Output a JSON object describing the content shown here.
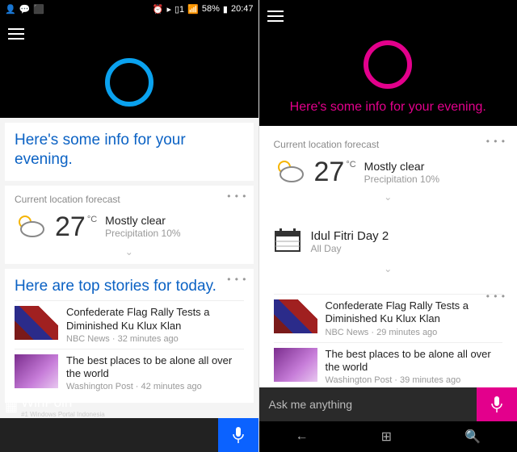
{
  "left": {
    "statusbar": {
      "battery": "58%",
      "time": "20:47"
    },
    "greeting": "Here's some info for your evening.",
    "forecast": {
      "label": "Current location forecast",
      "temp": "27",
      "unit": "°C",
      "condition": "Mostly clear",
      "precip": "Precipitation 10%"
    },
    "stories_heading": "Here are top stories for today.",
    "stories": [
      {
        "title": "Confederate Flag Rally Tests a Diminished Ku Klux Klan",
        "source": "NBC News",
        "age": "32 minutes ago"
      },
      {
        "title": "The best places to be alone all over the world",
        "source": "Washington Post",
        "age": "42 minutes ago"
      }
    ],
    "watermark": {
      "brand": "WinPoin",
      "tagline": "#1 Windows Portal Indonesia"
    }
  },
  "right": {
    "greeting": "Here's some info for your evening.",
    "forecast": {
      "label": "Current location forecast",
      "temp": "27",
      "unit": "°C",
      "condition": "Mostly clear",
      "precip": "Precipitation 10%"
    },
    "event": {
      "title": "Idul Fitri Day 2",
      "time": "All Day"
    },
    "stories": [
      {
        "title": "Confederate Flag Rally Tests a Diminished Ku Klux Klan",
        "source": "NBC News",
        "age": "29 minutes ago"
      },
      {
        "title": "The best places to be alone all over the world",
        "source": "Washington Post",
        "age": "39 minutes ago"
      }
    ],
    "search_placeholder": "Ask me anything"
  }
}
